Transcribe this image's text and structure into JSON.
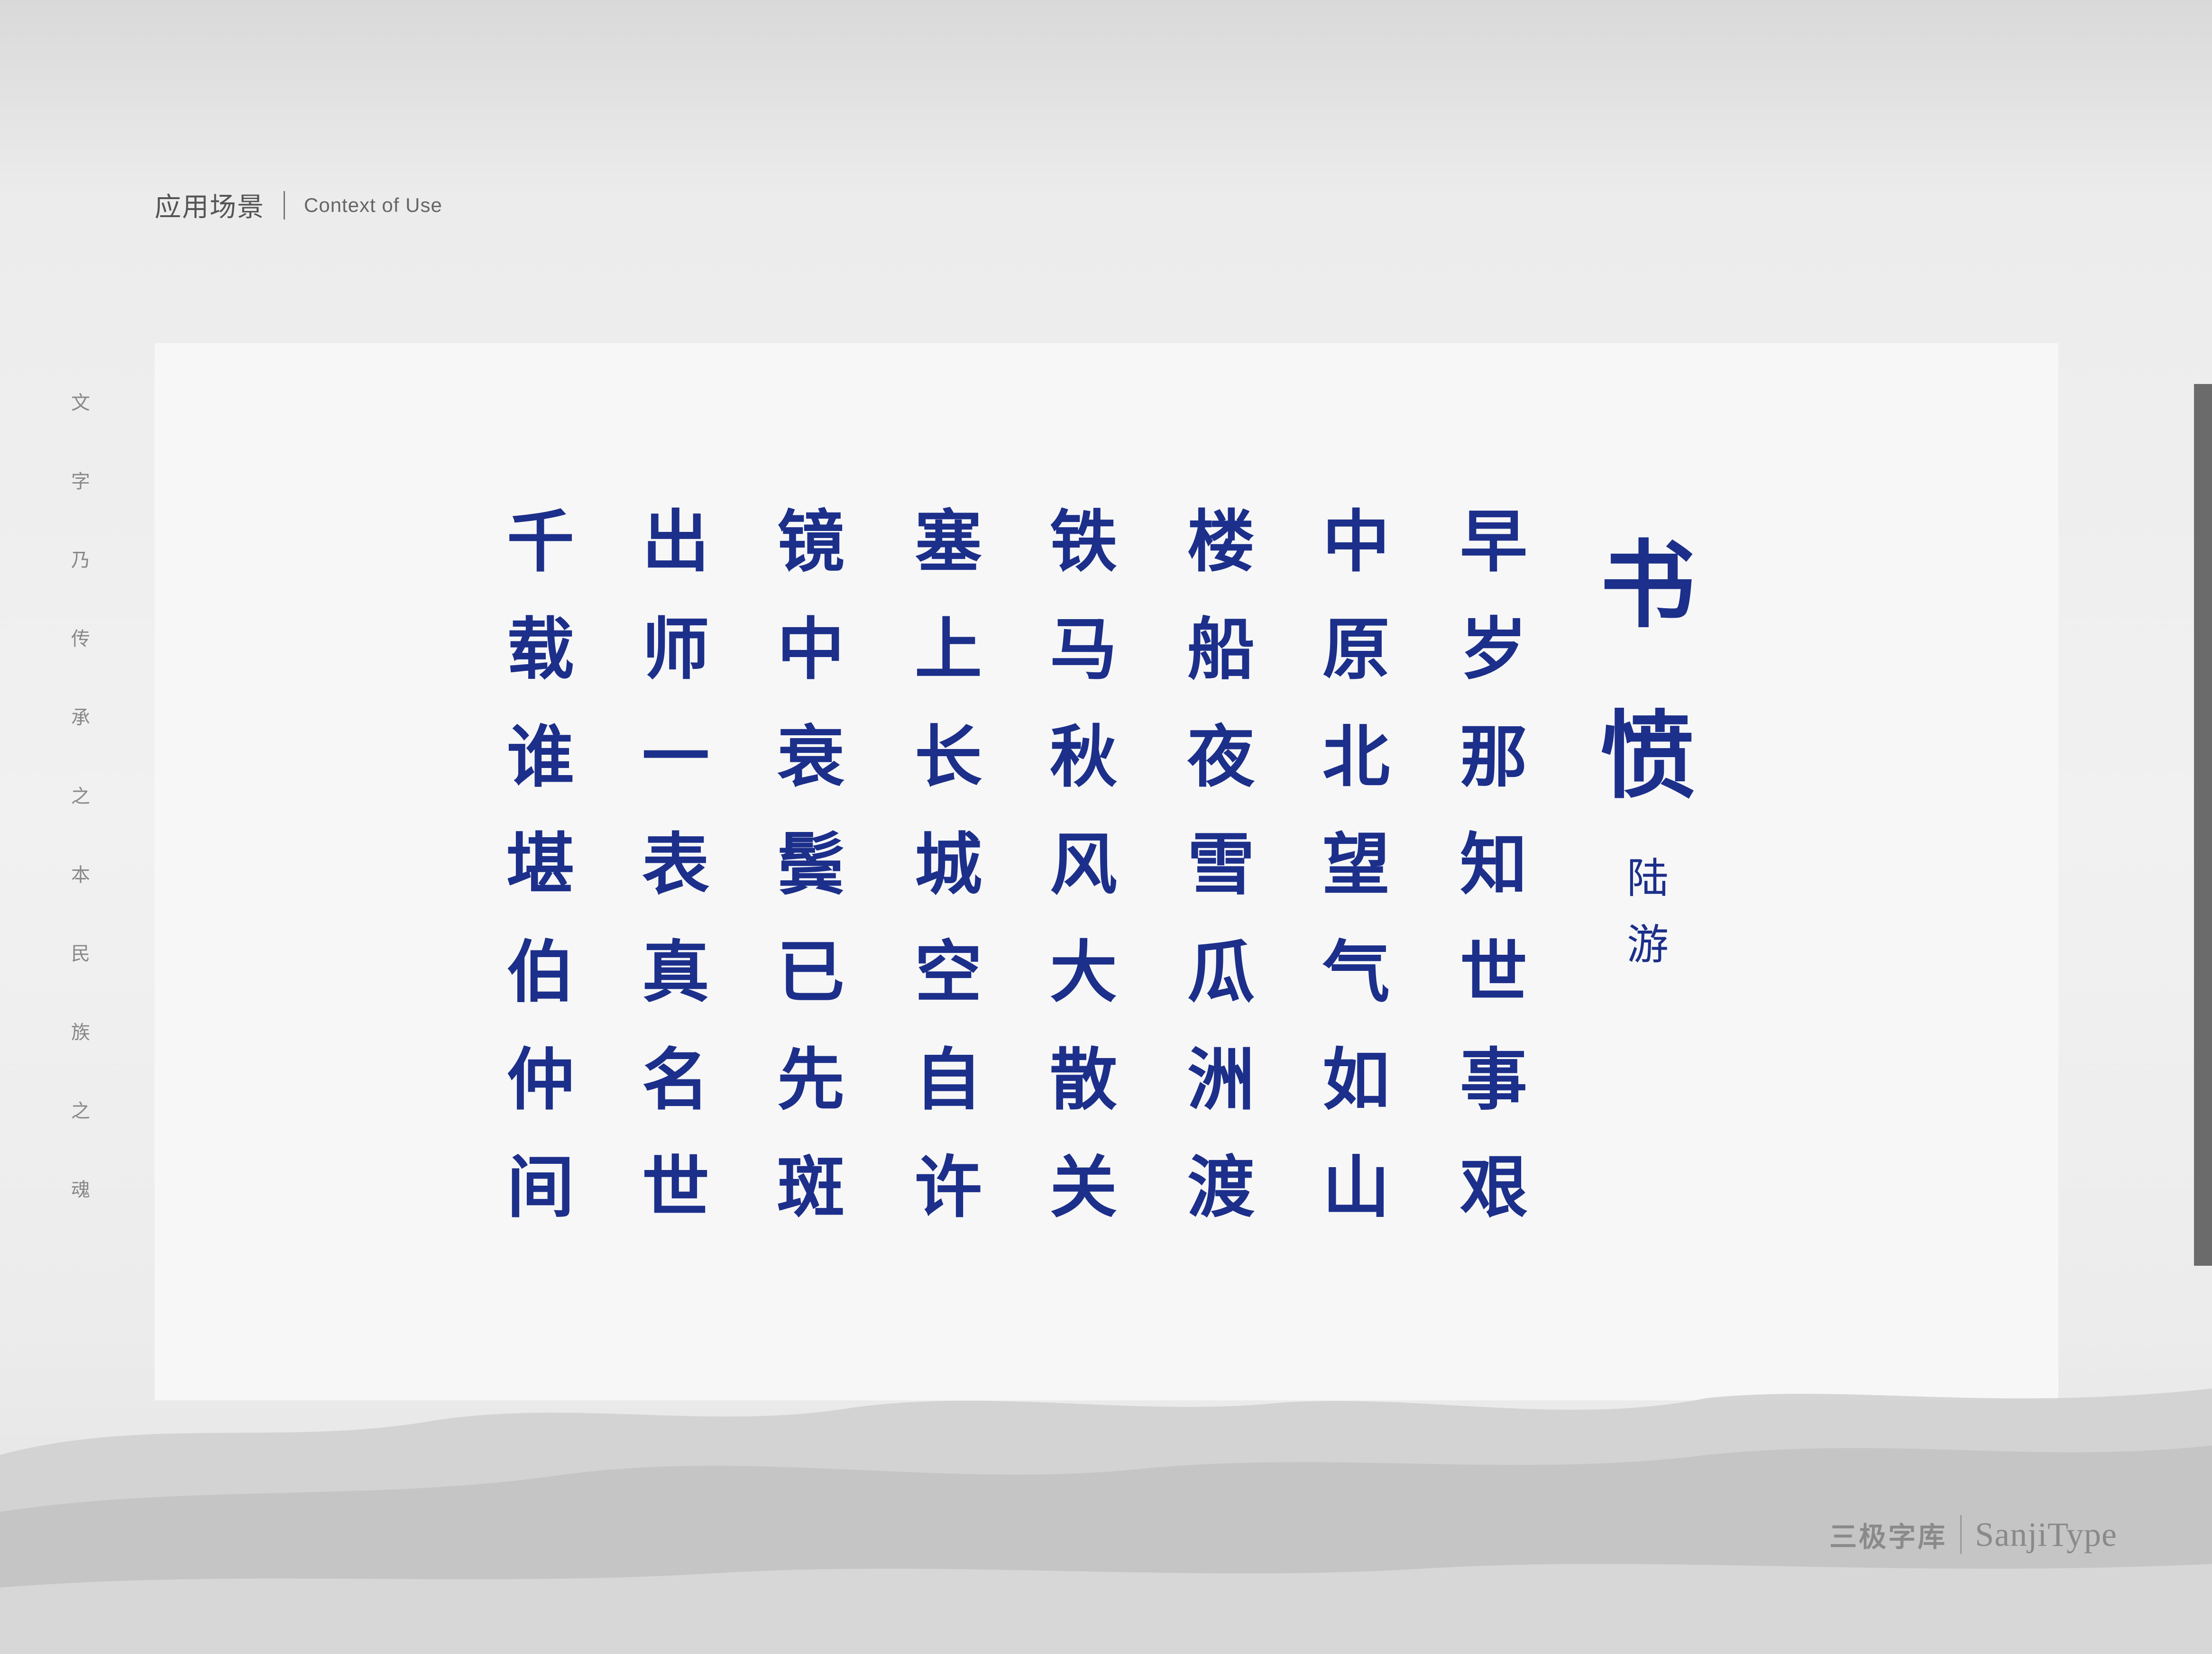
{
  "header": {
    "title_zh": "应用场景",
    "title_en": "Context of Use"
  },
  "side_text": [
    "文",
    "字",
    "乃",
    "传",
    "承",
    "之",
    "本",
    "民",
    "族",
    "之",
    "魂"
  ],
  "poem": {
    "title": [
      "书",
      "愤"
    ],
    "author": [
      "陆",
      "游"
    ],
    "columns": [
      [
        "早",
        "岁",
        "那",
        "知",
        "世",
        "事",
        "艰"
      ],
      [
        "中",
        "原",
        "北",
        "望",
        "气",
        "如",
        "山"
      ],
      [
        "楼",
        "船",
        "夜",
        "雪",
        "瓜",
        "洲",
        "渡"
      ],
      [
        "铁",
        "马",
        "秋",
        "风",
        "大",
        "散",
        "关"
      ],
      [
        "塞",
        "上",
        "长",
        "城",
        "空",
        "自",
        "许"
      ],
      [
        "镜",
        "中",
        "衰",
        "鬓",
        "已",
        "先",
        "斑"
      ],
      [
        "出",
        "师",
        "一",
        "表",
        "真",
        "名",
        "世"
      ],
      [
        "千",
        "载",
        "谁",
        "堪",
        "伯",
        "仲",
        "间"
      ]
    ]
  },
  "footer": {
    "brand_zh": "三极字库",
    "brand_en": "SanjiType"
  },
  "colors": {
    "ink_blue": "#1c2f8a",
    "card_bg": "#f7f7f7",
    "text_gray": "#555555"
  }
}
